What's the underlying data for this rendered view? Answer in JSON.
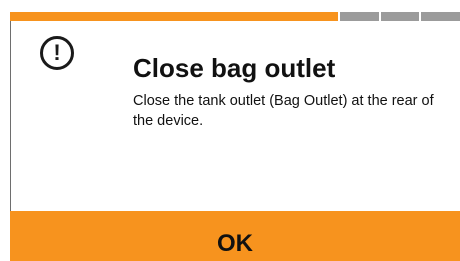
{
  "progress": {
    "completed_steps": 1,
    "total_steps": 4,
    "colors": {
      "done": "#f7931e",
      "todo": "#9b9b9b"
    }
  },
  "dialog": {
    "icon": "exclamation-circle-icon",
    "icon_glyph": "!",
    "title": "Close bag outlet",
    "message": "Close the tank outlet (Bag Outlet) at the rear of the device.",
    "ok_label": "OK",
    "accent_color": "#f7931e"
  }
}
